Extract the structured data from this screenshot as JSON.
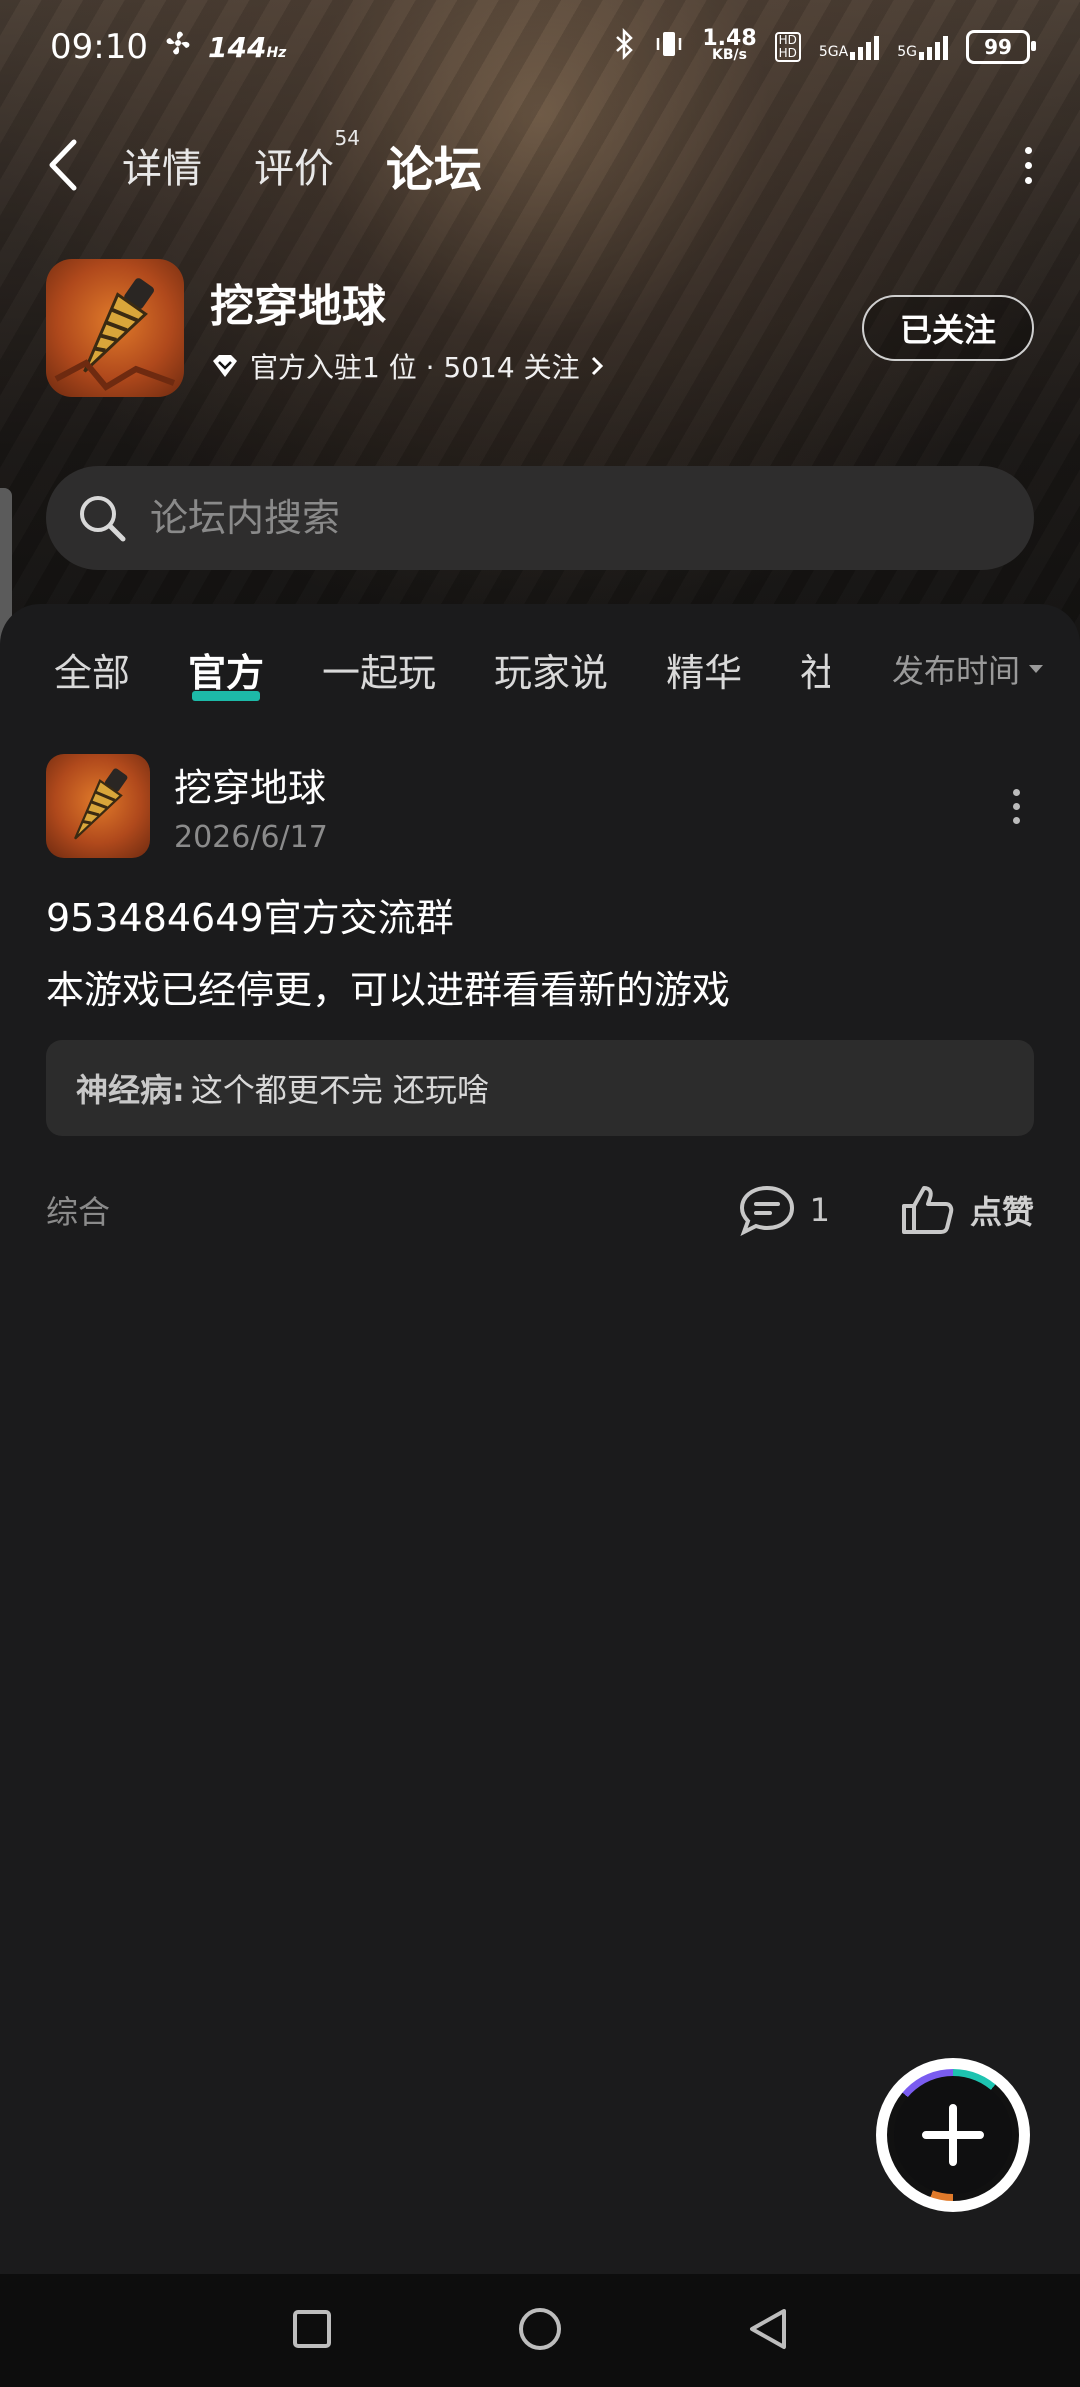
{
  "status_bar": {
    "time": "09:10",
    "refresh_rate": "144",
    "refresh_unit": "Hz",
    "network_speed": "1.48",
    "network_speed_unit": "KB/s",
    "sim1": "5GA",
    "sim2": "5G",
    "battery": "99"
  },
  "nav": {
    "tabs": [
      {
        "label": "详情"
      },
      {
        "label": "评价",
        "badge": "54"
      },
      {
        "label": "论坛"
      }
    ],
    "active_tab": "论坛"
  },
  "game": {
    "title": "挖穿地球",
    "meta": "官方入驻1 位 · 5014 关注",
    "follow_label": "已关注"
  },
  "search": {
    "placeholder": "论坛内搜索"
  },
  "filters": {
    "items": [
      "全部",
      "官方",
      "一起玩",
      "玩家说",
      "精华",
      "社"
    ],
    "active": "官方",
    "sort_label": "发布时间"
  },
  "post": {
    "author": "挖穿地球",
    "date": "2026/6/17",
    "title": "953484649官方交流群",
    "body": "本游戏已经停更，可以进群看看新的游戏",
    "comment_author": "神经病:",
    "comment_text": "这个都更不完 还玩啥",
    "category": "综合",
    "comment_count": "1",
    "like_label": "点赞"
  },
  "colors": {
    "accent": "#1ec3b0",
    "background": "#1b1b1c"
  }
}
